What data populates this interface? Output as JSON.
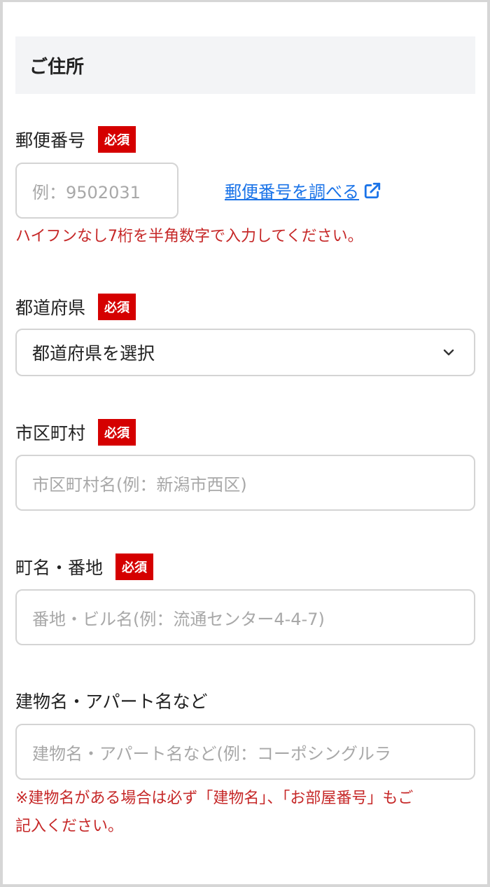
{
  "section": {
    "title": "ご住所"
  },
  "required_badge": "必須",
  "postal": {
    "label": "郵便番号",
    "placeholder": "例：9502031",
    "lookup_link": "郵便番号を調べる",
    "note": "ハイフンなし7桁を半角数字で入力してください。"
  },
  "prefecture": {
    "label": "都道府県",
    "selected": "都道府県を選択"
  },
  "city": {
    "label": "市区町村",
    "placeholder": "市区町村名(例：新潟市西区)"
  },
  "street": {
    "label": "町名・番地",
    "placeholder": "番地・ビル名(例：流通センター4-4-7)"
  },
  "building": {
    "label": "建物名・アパート名など",
    "placeholder": "建物名・アパート名など(例：コーポシングルラ",
    "note_line1": "※建物名がある場合は必ず「建物名」、「お部屋番号」もご",
    "note_line2": "記入ください。"
  },
  "colors": {
    "required_badge_bg": "#d50000",
    "note_text": "#c62828",
    "link": "#1a73e8",
    "section_bg": "#f3f4f6"
  },
  "icons": {
    "lookup_link_icon": "external-link-icon",
    "select_chevron": "chevron-down-icon"
  }
}
